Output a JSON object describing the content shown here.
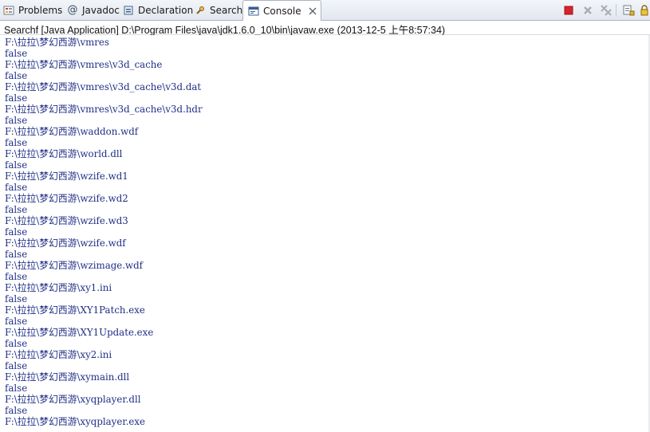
{
  "tabs": [
    {
      "id": "problems",
      "label": "Problems",
      "active": false
    },
    {
      "id": "javadoc",
      "label": "Javadoc",
      "active": false
    },
    {
      "id": "declaration",
      "label": "Declaration",
      "active": false
    },
    {
      "id": "search",
      "label": "Search",
      "active": false
    },
    {
      "id": "console",
      "label": "Console",
      "active": true
    }
  ],
  "close_glyph": "✕",
  "toolbar": {
    "terminate_icon": "terminate-icon",
    "remove_launch_icon": "remove-launch-icon",
    "remove_all_icon": "remove-all-terminated-icon",
    "scroll_lock_icon": "scroll-lock-icon",
    "lock_icon": "lock-icon"
  },
  "console": {
    "header": "Searchf [Java Application] D:\\Program Files\\java\\jdk1.6.0_10\\bin\\javaw.exe (2013-12-5 上午8:57:34)",
    "lines": [
      "F:\\拉拉\\梦幻西游\\vmres",
      "false",
      "F:\\拉拉\\梦幻西游\\vmres\\v3d_cache",
      "false",
      "F:\\拉拉\\梦幻西游\\vmres\\v3d_cache\\v3d.dat",
      "false",
      "F:\\拉拉\\梦幻西游\\vmres\\v3d_cache\\v3d.hdr",
      "false",
      "F:\\拉拉\\梦幻西游\\waddon.wdf",
      "false",
      "F:\\拉拉\\梦幻西游\\world.dll",
      "false",
      "F:\\拉拉\\梦幻西游\\wzife.wd1",
      "false",
      "F:\\拉拉\\梦幻西游\\wzife.wd2",
      "false",
      "F:\\拉拉\\梦幻西游\\wzife.wd3",
      "false",
      "F:\\拉拉\\梦幻西游\\wzife.wdf",
      "false",
      "F:\\拉拉\\梦幻西游\\wzimage.wdf",
      "false",
      "F:\\拉拉\\梦幻西游\\xy1.ini",
      "false",
      "F:\\拉拉\\梦幻西游\\XY1Patch.exe",
      "false",
      "F:\\拉拉\\梦幻西游\\XY1Update.exe",
      "false",
      "F:\\拉拉\\梦幻西游\\xy2.ini",
      "false",
      "F:\\拉拉\\梦幻西游\\xymain.dll",
      "false",
      "F:\\拉拉\\梦幻西游\\xyqplayer.dll",
      "false",
      "F:\\拉拉\\梦幻西游\\xyqplayer.exe"
    ]
  },
  "colors": {
    "console_text": "#1f2e86",
    "terminate": "#d8232a",
    "tab_bar": "#e3e8ee"
  }
}
